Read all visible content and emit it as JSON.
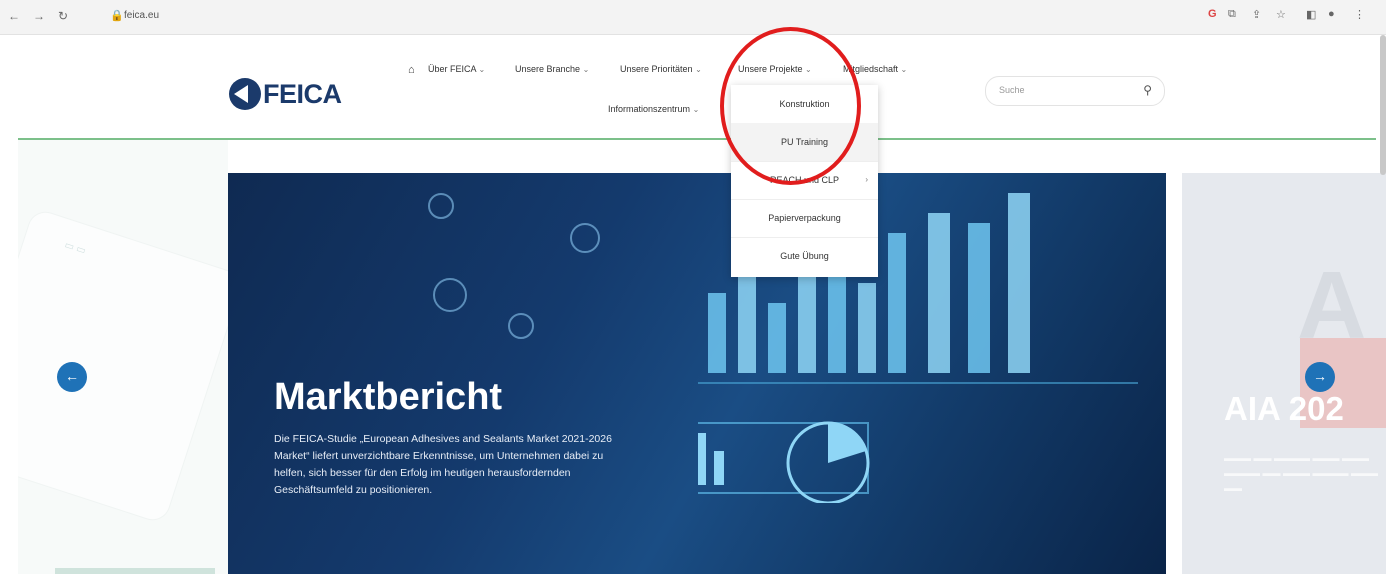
{
  "browser": {
    "url": "feica.eu"
  },
  "site": {
    "logo_text": "FEICA",
    "menu": [
      {
        "label": "Über FEICA",
        "has_dropdown": true
      },
      {
        "label": "Unsere Branche",
        "has_dropdown": true
      },
      {
        "label": "Unsere Prioritäten",
        "has_dropdown": true
      },
      {
        "label": "Unsere Projekte",
        "has_dropdown": true
      },
      {
        "label": "Mitgliedschaft",
        "has_dropdown": true
      },
      {
        "label": "Informationszentrum",
        "has_dropdown": true
      }
    ],
    "search_placeholder": "Suche",
    "dropdown_items": [
      {
        "label": "Konstruktion"
      },
      {
        "label": "PU Training"
      },
      {
        "label": "REACH und CLP",
        "has_submenu": true
      },
      {
        "label": "Papierverpackung"
      },
      {
        "label": "Gute Übung"
      }
    ]
  },
  "slider": {
    "main": {
      "title": "Marktbericht",
      "description": "Die FEICA-Studie „European Adhesives and Sealants Market 2021-2026 Market“ liefert unverzichtbare Erkenntnisse, um Unternehmen dabei zu helfen, sich besser für den Erfolg im heutigen herausfordernden Geschäftsumfeld zu positionieren."
    },
    "next": {
      "title": "AIA 202"
    }
  },
  "colors": {
    "brand_blue": "#1b3a6b",
    "accent_green": "#7cc08a",
    "arrow_blue": "#1f72b7",
    "highlight_red": "#e11d1d"
  }
}
